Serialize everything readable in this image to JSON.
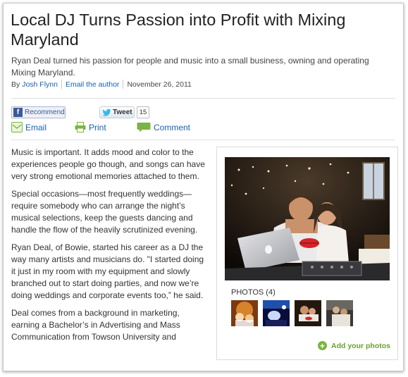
{
  "article": {
    "headline": "Local DJ Turns Passion into Profit with Mixing Maryland",
    "subheadline": "Ryan Deal turned his passion for people and music into a small business, owning and operating Mixing Maryland.",
    "by_prefix": "By",
    "author": "Josh Flynn",
    "email_author": "Email the author",
    "date": "November 26, 2011",
    "paragraphs": [
      "Music is important. It adds mood and color to the experiences people go though, and songs can have very strong emotional memories attached to them.",
      "Special occasions—most frequently weddings—require somebody who can arrange the night’s musical selections, keep the guests dancing and handle the flow of the heavily scrutinized evening.",
      "Ryan Deal, of Bowie, started his career as a DJ the way many artists and musicians do. \"I started doing it just in my room with my equipment and slowly branched out to start doing parties, and now we’re doing weddings and corporate events too,” he said.",
      "Deal comes from a background in marketing, earning a Bachelor’s in Advertising and Mass Communication from Towson University and"
    ]
  },
  "social": {
    "recommend_label": "Recommend",
    "tweet_label": "Tweet",
    "tweet_count": "15",
    "email_label": "Email",
    "print_label": "Print",
    "comment_label": "Comment"
  },
  "photos": {
    "label": "PHOTOS (4)",
    "add_label": "Add your photos"
  },
  "icons": {
    "facebook": "facebook-icon",
    "twitter": "twitter-bird-icon",
    "email": "envelope-icon",
    "print": "printer-icon",
    "comment": "speech-bubble-icon",
    "add": "plus-circle-icon"
  },
  "colors": {
    "link": "#1a5fb4",
    "facebook": "#3b5998",
    "share_green": "#7cb342",
    "add_photos": "#6aa02c"
  }
}
